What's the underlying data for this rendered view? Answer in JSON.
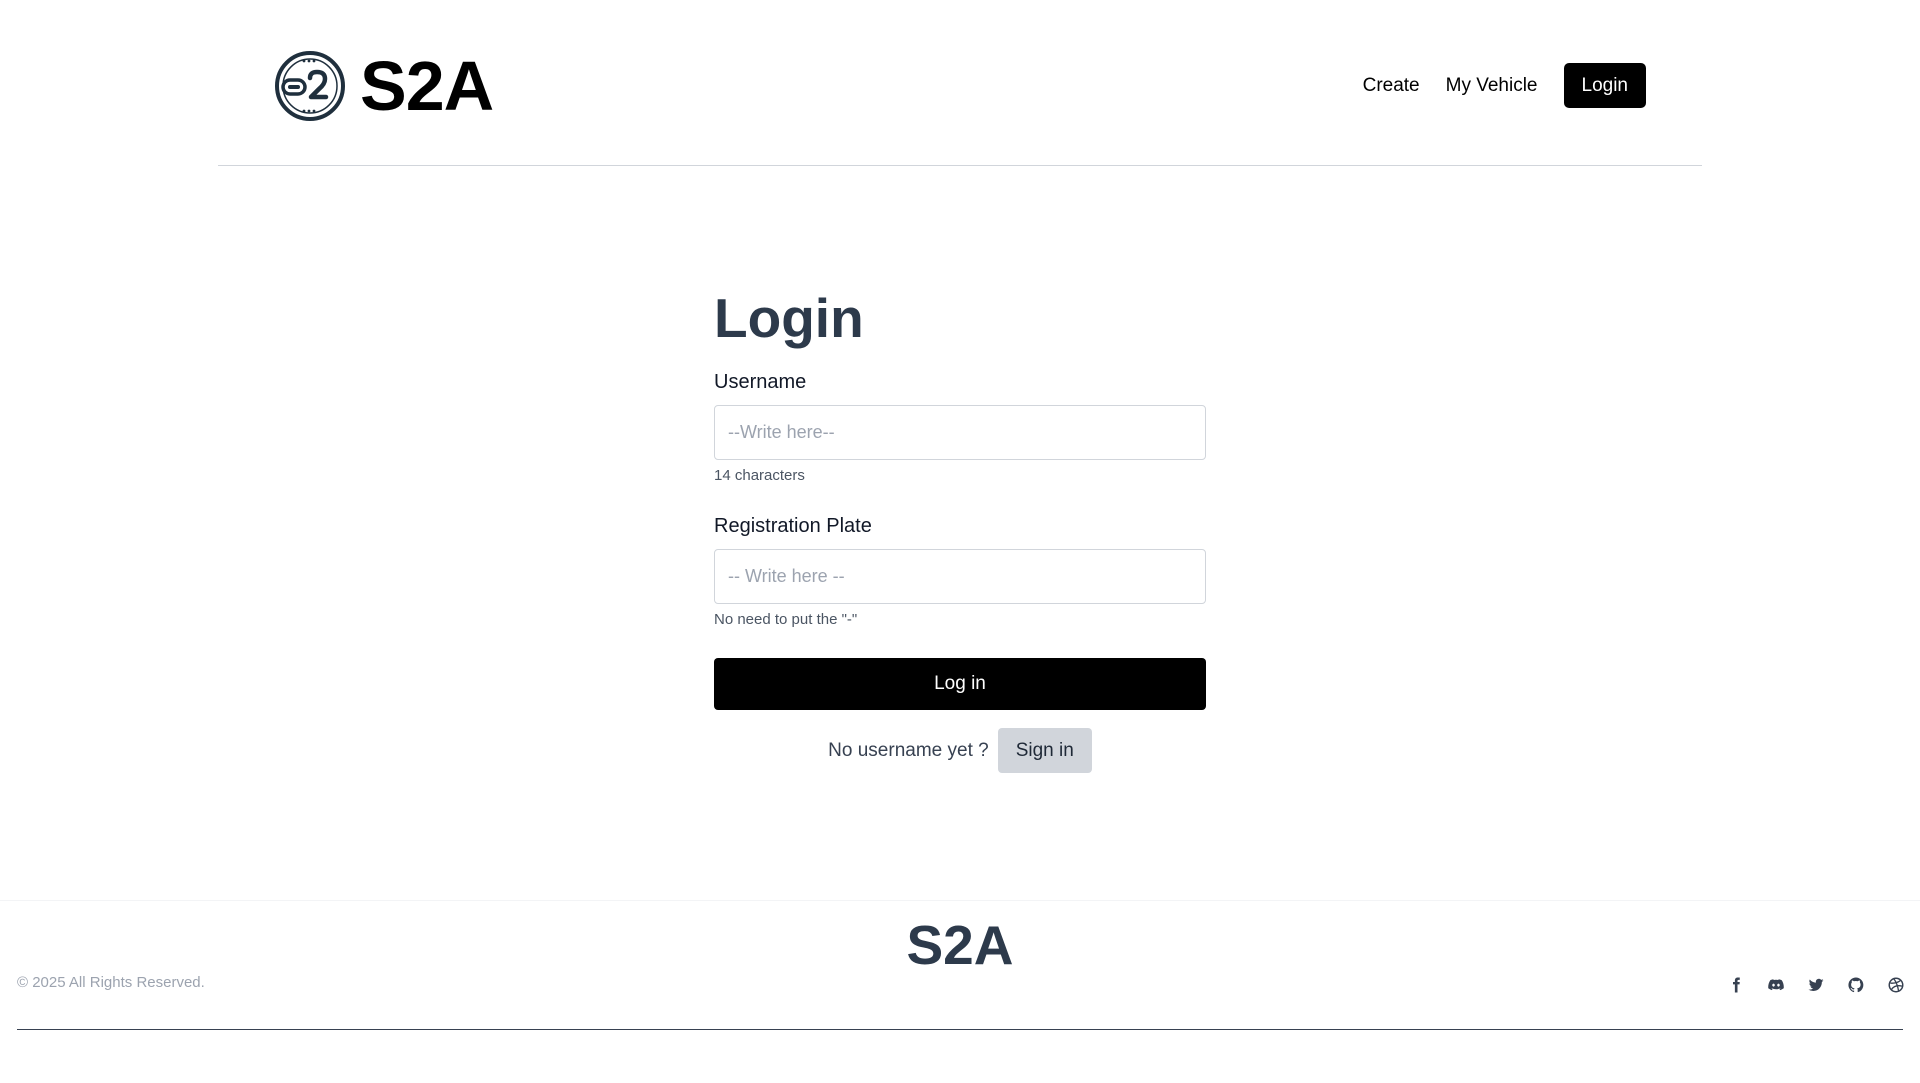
{
  "header": {
    "brand_name": "S2A",
    "nav": {
      "create_label": "Create",
      "my_vehicle_label": "My Vehicle",
      "login_label": "Login"
    }
  },
  "form": {
    "title": "Login",
    "username": {
      "label": "Username",
      "value": "",
      "placeholder": "--Write here--",
      "hint": "14 characters"
    },
    "plate": {
      "label": "Registration Plate",
      "value": "",
      "placeholder": "-- Write here --",
      "hint": "No need to put the \"-\""
    },
    "submit_label": "Log in",
    "signup_prompt": "No username yet ?",
    "signup_label": "Sign in"
  },
  "footer": {
    "brand_name": "S2A",
    "copyright": "© 2025 All Rights Reserved.",
    "social_icons": [
      "facebook-icon",
      "discord-icon",
      "twitter-icon",
      "github-icon",
      "dribbble-icon"
    ]
  },
  "colors": {
    "heading": "#2d3a4b",
    "primary_button": "#000000",
    "secondary_button": "#d1d5db",
    "muted_text": "#9ca3af"
  }
}
